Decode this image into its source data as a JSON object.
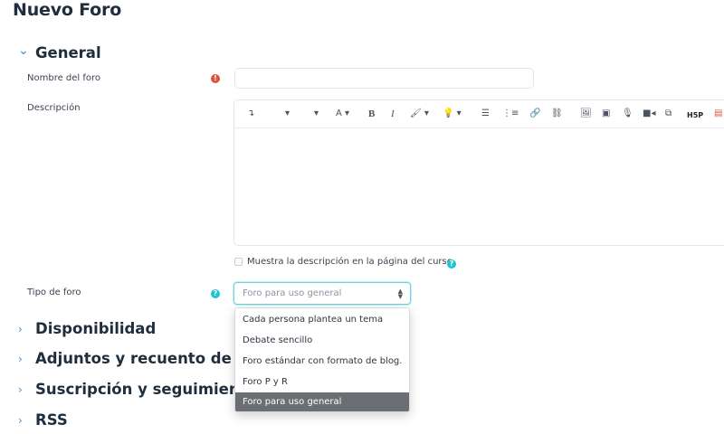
{
  "page": {
    "title": "Nuevo Foro"
  },
  "sections": {
    "general": {
      "chevron": "⌄",
      "title": "General"
    },
    "availability": {
      "chevron": "›",
      "title": "Disponibilidad"
    },
    "attachments": {
      "chevron": "›",
      "title": "Adjuntos y recuento de pa"
    },
    "subscription": {
      "chevron": "›",
      "title": "Suscripción y seguimiento"
    },
    "rss": {
      "chevron": "›",
      "title": "RSS"
    }
  },
  "form": {
    "name_label": "Nombre del foro",
    "name_value": "",
    "required_icon": "!",
    "description_label": "Descripción",
    "show_description_label": "Muestra la descripción en la página del curso",
    "help_icon": "?",
    "forum_type_label": "Tipo de foro",
    "forum_type_selected": "Foro para uso general",
    "forum_type_options": [
      "Cada persona plantea un tema",
      "Debate sencillo",
      "Foro estándar con formato de blog.",
      "Foro P y R",
      "Foro para uso general"
    ]
  },
  "toolbar": {
    "undo": "↴",
    "para_style": "▾",
    "font_family": "▾",
    "font_size": "A ▾",
    "bold": "B",
    "italic": "I",
    "highlight": "🖌 ▾",
    "lightbulb": "💡 ▾",
    "bullet_list": "☰",
    "numbered_list": "⋮≡",
    "link": "🔗",
    "unlink": "⛓",
    "image": "🖼",
    "media": "▣",
    "record_audio": "🎙",
    "record_video": "■◂",
    "copy": "⧉",
    "h5p": "H5P",
    "pdf": "▤"
  }
}
